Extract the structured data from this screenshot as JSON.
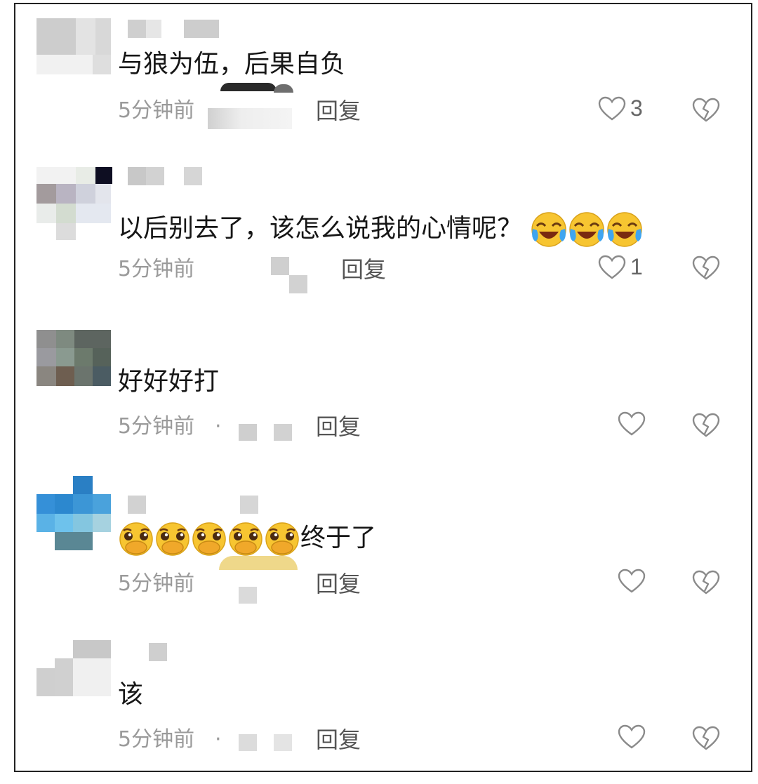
{
  "comments": [
    {
      "text": "与狼为伍，后果自负",
      "time": "5分钟前",
      "reply": "回复",
      "likes": "3",
      "icons": {
        "like": "heart-outline-icon",
        "dislike": "broken-heart-icon"
      }
    },
    {
      "text": "以后别去了，该怎么说我的心情呢？",
      "emoji_suffix": [
        "laugh-cry-emoji",
        "laugh-cry-emoji",
        "laugh-cry-emoji"
      ],
      "time": "5分钟前",
      "reply": "回复",
      "likes": "1"
    },
    {
      "text": "好好好打",
      "time": "5分钟前",
      "dot": "·",
      "reply": "回复",
      "likes": ""
    },
    {
      "emoji_prefix": [
        "pleading-cover-mouth-emoji",
        "pleading-cover-mouth-emoji",
        "pleading-cover-mouth-emoji",
        "pleading-cover-mouth-emoji",
        "pleading-cover-mouth-emoji"
      ],
      "text": "终于了",
      "time": "5分钟前",
      "reply": "回复",
      "likes": ""
    },
    {
      "text": "该",
      "time": "5分钟前",
      "dot": "·",
      "reply": "回复",
      "likes": ""
    }
  ],
  "colors": {
    "text": "#161616",
    "meta": "#9a9a9a",
    "emoji_face": "#f7c531",
    "emoji_tears": "#3fa5f0"
  }
}
